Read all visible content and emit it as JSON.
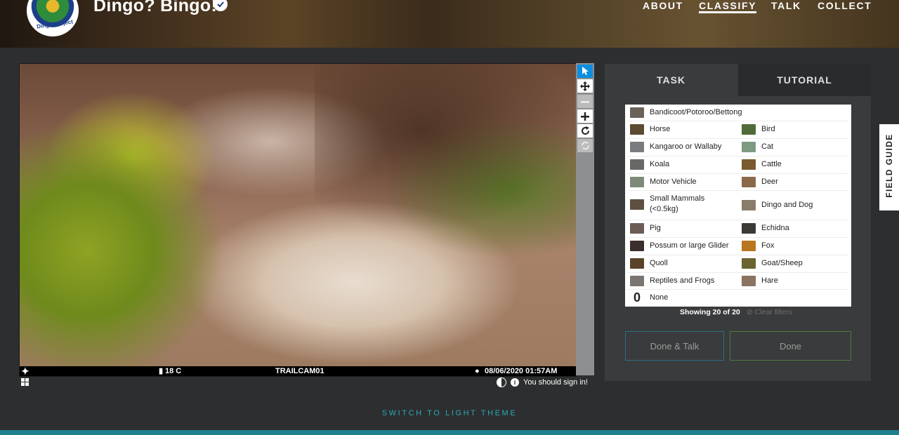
{
  "header": {
    "logo_text": "Dingo Project",
    "title": "Dingo? Bingo!",
    "nav": [
      {
        "label": "ABOUT"
      },
      {
        "label": "CLASSIFY"
      },
      {
        "label": "TALK"
      },
      {
        "label": "COLLECT"
      }
    ]
  },
  "viewer": {
    "cam_temp": "18 C",
    "cam_name": "TRAILCAM01",
    "cam_datetime": "08/06/2020 01:57AM",
    "signin_text": "You should sign in!",
    "tools": [
      "pointer-icon",
      "move-icon",
      "zoom-out-icon",
      "zoom-in-icon",
      "rotate-icon",
      "reset-icon"
    ]
  },
  "task_panel": {
    "tabs": [
      {
        "label": "TASK"
      },
      {
        "label": "TUTORIAL"
      }
    ],
    "choices_left": [
      {
        "label": "Bandicoot/Potoroo/Bettong",
        "color": "#6b6259"
      },
      {
        "label": "Horse",
        "color": "#5d4a32"
      },
      {
        "label": "Kangaroo or Wallaby",
        "color": "#7b7c80"
      },
      {
        "label": "Koala",
        "color": "#6a6866"
      },
      {
        "label": "Motor Vehicle",
        "color": "#7d8a7a"
      },
      {
        "label": "Small Mammals (<0.5kg)",
        "color": "#5e5040"
      },
      {
        "label": "Pig",
        "color": "#6c5c55"
      },
      {
        "label": "Possum or large Glider",
        "color": "#3a2f2c"
      },
      {
        "label": "Quoll",
        "color": "#5a4328"
      },
      {
        "label": "Reptiles and Frogs",
        "color": "#7a7570"
      },
      {
        "label": "None",
        "color": "#ffffff"
      }
    ],
    "choices_right": [
      {
        "label": "Bird",
        "color": "#4f6b3a"
      },
      {
        "label": "Cat",
        "color": "#7e9a82"
      },
      {
        "label": "Cattle",
        "color": "#7a5a2e"
      },
      {
        "label": "Deer",
        "color": "#8a6a4a"
      },
      {
        "label": "Dingo and Dog",
        "color": "#8a7c6a"
      },
      {
        "label": "Echidna",
        "color": "#3b3a36"
      },
      {
        "label": "Fox",
        "color": "#b8761e"
      },
      {
        "label": "Goat/Sheep",
        "color": "#6a6430"
      },
      {
        "label": "Hare",
        "color": "#8a7360"
      }
    ],
    "showing": "Showing 20 of 20",
    "clear_filters": "Clear filters",
    "done_talk": "Done & Talk",
    "done": "Done"
  },
  "field_guide": "FIELD GUIDE",
  "switch_theme": "SWITCH TO LIGHT THEME"
}
